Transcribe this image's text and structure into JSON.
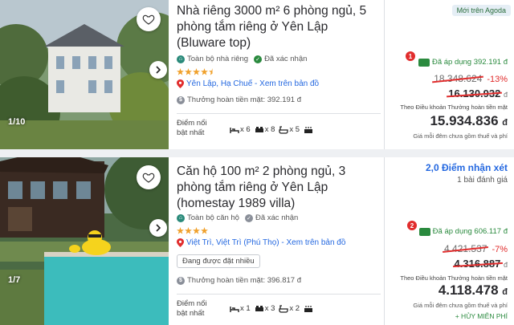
{
  "listings": [
    {
      "photo_counter": "1/10",
      "title": "Nhà riêng 3000 m² 6 phòng ngủ, 5 phòng tắm riêng ở Yên Lập (Bluware top)",
      "property_type": "Toàn bộ nhà riêng",
      "verified": "Đã xác nhận",
      "star_rating": 4.5,
      "location": "Yên Lập, Hạ Chuế - Xem trên bản đồ",
      "cashback": "Thưởng hoàn tiền mặt: 392.191 đ",
      "amenities_label": "Điểm nổi bật nhất",
      "amenities": [
        {
          "icon": "bed-icon",
          "count": "x 6"
        },
        {
          "icon": "double-bed-icon",
          "count": "x 8"
        },
        {
          "icon": "bathtub-icon",
          "count": "x 5"
        },
        {
          "icon": "kitchen-icon",
          "count": ""
        }
      ],
      "new_badge": "Mới trên Agoda",
      "badge_number": "1",
      "coupon_applied": "Đã áp dụng 392.191 đ",
      "original_price": "18.348.624",
      "discount": "-13%",
      "mid_price": "16.130.932",
      "cashback_terms": "Theo Điều khoản Thưởng hoàn tiền mặt",
      "final_price": "15.934.836",
      "currency": "đ",
      "price_note": "Giá mỗi đêm chưa gồm thuế và phí"
    },
    {
      "photo_counter": "1/7",
      "title": "Căn hộ 100 m² 2 phòng ngủ, 3 phòng tắm riêng ở Yên Lập (homestay 1989 villa)",
      "property_type": "Toàn bộ căn hộ",
      "verified": "Đã xác nhận",
      "star_rating": 4,
      "location": "Việt Trì, Việt Trì (Phú Thọ) - Xem trên bản đồ",
      "popular_tag": "Đang được đặt nhiều",
      "cashback": "Thưởng hoàn tiền mặt: 396.817 đ",
      "amenities_label": "Điểm nổi bật nhất",
      "amenities": [
        {
          "icon": "bed-icon",
          "count": "x 1"
        },
        {
          "icon": "double-bed-icon",
          "count": "x 3"
        },
        {
          "icon": "bathtub-icon",
          "count": "x 2"
        },
        {
          "icon": "kitchen-icon",
          "count": ""
        }
      ],
      "review_score": "2,0 Điểm nhận xét",
      "review_count": "1 bài đánh giá",
      "badge_number": "2",
      "coupon_applied": "Đã áp dụng 606.117 đ",
      "original_price": "4.421.537",
      "discount": "-7%",
      "mid_price": "4.316.887",
      "cashback_terms": "Theo Điều khoản Thưởng hoàn tiền mặt",
      "final_price": "4.118.478",
      "currency": "đ",
      "price_note": "Giá mỗi đêm chưa gồm thuế và phí",
      "free_cancel": "+ HỦY MIỄN PHÍ"
    }
  ],
  "colors": {
    "link": "#2468e0",
    "green": "#2a8a3e",
    "red": "#e12d2d",
    "star": "#f0a02a"
  }
}
